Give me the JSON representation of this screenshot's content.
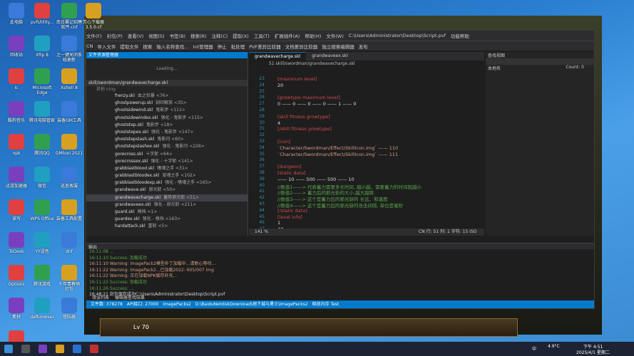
{
  "desktop_icons": [
    {
      "label": "此电脑"
    },
    {
      "label": "pvfUtility..."
    },
    {
      "label": "南日翼记招聘\n软件.cnf"
    },
    {
      "label": "芳心下载器\n3.5.0.cf"
    },
    {
      "label": "回收站"
    },
    {
      "label": "Xftp 8"
    },
    {
      "label": "之一键关闭系\n统更新"
    },
    {
      "label": "ic"
    },
    {
      "label": "Microsoft\nEdge"
    },
    {
      "label": "Xshell 8"
    },
    {
      "label": "酷狗音乐"
    },
    {
      "label": "腾讯电脑管家"
    },
    {
      "label": "装备GM工具"
    },
    {
      "label": "npk"
    },
    {
      "label": "腾讯QQ"
    },
    {
      "label": "GMtool 2021"
    },
    {
      "label": "迅游加速器"
    },
    {
      "label": "微信"
    },
    {
      "label": "巡查客服"
    },
    {
      "label": "读写"
    },
    {
      "label": "WPS Office"
    },
    {
      "label": "装备工具配置"
    },
    {
      "label": "ToDesk"
    },
    {
      "label": "YY语音"
    },
    {
      "label": "dnf"
    },
    {
      "label": "Options"
    },
    {
      "label": "腾讯游戏"
    },
    {
      "label": "千年青春萌\n打包"
    },
    {
      "label": "素材"
    },
    {
      "label": "dafbrowser"
    },
    {
      "label": "登陆器"
    },
    {
      "label": "pvfUtility..."
    }
  ],
  "window": {
    "title": "C:\\Users\\Administrator\\Desktop\\Script.pvf",
    "menus": [
      "文件(F)",
      "封包(P)",
      "查看(V)",
      "视图(S)",
      "书签(B)",
      "搜索(R)",
      "注释(C)",
      "提取(X)",
      "工具(T)",
      "扩展插件(A)",
      "帮助(H)",
      "文件(W)"
    ],
    "extra_label": "功能帮助",
    "toolbar": [
      "CN",
      "导入文件",
      "提取文件",
      "搜索",
      "输入名称查找..."
    ],
    "toolbar_right": [
      "Int管理器",
      "停止",
      "批处理",
      "PVF差异比较器",
      "文档差异比较器",
      "独立搜索编辑器",
      "发布"
    ],
    "user": "天德酮酮"
  },
  "explorer": {
    "header": "文件资源管理器",
    "loading": "Loading...",
    "path": "skill/swordman/grandwavecharge.skl",
    "filter": "其他 ning",
    "files": [
      {
        "name": "frenzy.skl",
        "desc": "血之狂暴 <76>"
      },
      {
        "name": "ghostpowerup.skl",
        "desc": "刻印解放 <35>"
      },
      {
        "name": "ghostsidewind.skl",
        "desc": "鬼影步 <111>"
      },
      {
        "name": "ghostsidewindex.skl",
        "desc": "强化 - 鬼影步 <115>"
      },
      {
        "name": "ghoststep.skl",
        "desc": "鬼影步 <18>"
      },
      {
        "name": "ghoststepex.skl",
        "desc": "强化 - 鬼影步 <147>"
      },
      {
        "name": "ghoststepslash.skl",
        "desc": "鬼影闪 <60>"
      },
      {
        "name": "ghoststepslashex.skl",
        "desc": "强化 - 鬼影闪 <226>"
      },
      {
        "name": "gorecross.skl",
        "desc": "十字斩 <64>"
      },
      {
        "name": "gorecrossex.skl",
        "desc": "强化 - 十字斩 <141>"
      },
      {
        "name": "grabblastblood.skl",
        "desc": "嗜魂之手 <31>"
      },
      {
        "name": "grabblastbloodex.skl",
        "desc": "宠魂之手 <102>"
      },
      {
        "name": "grabblastbloodexp.skl",
        "desc": "强化 - 嗜魂之手 <165>"
      },
      {
        "name": "grandwave.skl",
        "desc": "邪光斩 <50>"
      },
      {
        "name": "grandwavecharge.skl",
        "desc": "蓄势邪光斩 <51>"
      },
      {
        "name": "grandwaveex.skl",
        "desc": "强化 - 邪光斩 <211>"
      },
      {
        "name": "guard.skl",
        "desc": "格挡 <1>"
      },
      {
        "name": "guardex.skl",
        "desc": "强化 - 格挡 <163>"
      },
      {
        "name": "hardattack.skl",
        "desc": "重斩 <5>"
      }
    ]
  },
  "editor": {
    "tabs": [
      "grandwavecharge.skl",
      "grandwaveex.skl"
    ],
    "path": "51  skill/swordman/grandwavecharge.skl",
    "lines": [
      {
        "n": "23",
        "t": "[maximum level]",
        "c": "red"
      },
      {
        "n": "24",
        "t": "20",
        "c": "wht"
      },
      {
        "n": "25",
        "t": "",
        "c": "wht"
      },
      {
        "n": "26",
        "t": "[growtype maximum level]",
        "c": "red"
      },
      {
        "n": "27",
        "t": "0 —— 0 —— 0 —— 0 —— 1 —— 0",
        "c": "wht"
      },
      {
        "n": "28",
        "t": "",
        "c": "wht"
      },
      {
        "n": "29",
        "t": "[skill fitness growtype]",
        "c": "red"
      },
      {
        "n": "30",
        "t": "4",
        "c": "wht"
      },
      {
        "n": "31",
        "t": "[/skill fitness growtype]",
        "c": "red"
      },
      {
        "n": "32",
        "t": "",
        "c": "wht"
      },
      {
        "n": "33",
        "t": "[icon]",
        "c": "red"
      },
      {
        "n": "34",
        "t": "`Character/Swordman/Effect/SkillIcon.img` —— 110",
        "c": "org"
      },
      {
        "n": "35",
        "t": "`Character/Swordman/Effect/SkillIcon.img` —— 111",
        "c": "org"
      },
      {
        "n": "36",
        "t": "",
        "c": "wht"
      },
      {
        "n": "37",
        "t": "[dungeon]",
        "c": "red"
      },
      {
        "n": "38",
        "t": "[static data]",
        "c": "red"
      },
      {
        "n": "39",
        "t": "—— 10 —— 500 —— 500 —— 10",
        "c": "wht"
      },
      {
        "n": "40",
        "t": "//数值1——> 代表蓄力需要多长时间, 越小越，需要蓄力的时间就越小",
        "c": "grn"
      },
      {
        "n": "41",
        "t": "//数值2——> 蓄力后的邪光斩的大小,越大越爽",
        "c": "grn"
      },
      {
        "n": "42",
        "t": "//数值3——> 这个是蓄力后的邪光斩的 长远，和速度",
        "c": "grn"
      },
      {
        "n": "43",
        "t": "//数值4——> 这个是蓄力后的邪光斩的攻击间隔, 单位是毫秒",
        "c": "grn"
      },
      {
        "n": "44",
        "t": "[/static data]",
        "c": "red"
      },
      {
        "n": "45",
        "t": "[level info]",
        "c": "red"
      },
      {
        "n": "46",
        "t": "1",
        "c": "wht"
      },
      {
        "n": "47",
        "t": "40",
        "c": "wht"
      }
    ],
    "statusbar": "141 %",
    "cursor": "CN 行: 51  列: 1  字符: 15  ISO"
  },
  "rightpanel": {
    "header": "查找视图",
    "sub": "本地名",
    "count": "Count: 0"
  },
  "output": {
    "header": "输出",
    "lines": [
      {
        "t": "16:11:08  ...",
        "c": "grn"
      },
      {
        "t": "16:11:10  Success: 加载成功",
        "c": "grn"
      },
      {
        "t": "16:11:10  Warning:  ImagePack2模型补丁加载中...请耐心等待...",
        "c": "org"
      },
      {
        "t": "16:11:22  Warning:  ImagePack2...已加载2022: 605/007 img",
        "c": "org"
      },
      {
        "t": "16:11:22  Warning:  正在加载NPK缓存补充...",
        "c": "org"
      },
      {
        "t": "16:11:22  Success: 加载成功",
        "c": "grn"
      },
      {
        "t": "16:11:26  Success: ...",
        "c": "grn"
      },
      {
        "t": "16:48:21  封包保存成功C:\\Users\\Administrator\\Desktop\\Script.pvf",
        "c": "wht"
      }
    ],
    "tabs": [
      "错误列表",
      "编辑器查找结果"
    ]
  },
  "status": {
    "items": [
      "文件数: 378278",
      "API接口: 27000",
      "ImagePacks2",
      "D:\\BaiduNetdiskDownload\\地下城与勇士\\ImagePacks2",
      "释放内存  Test"
    ]
  },
  "game": {
    "level": "Lv 70",
    "title": "dnf"
  },
  "taskbar": {
    "time": "下午 4:51",
    "date": "2025/4/1 星期二",
    "temp": "4.9°C",
    "lang": "中"
  }
}
